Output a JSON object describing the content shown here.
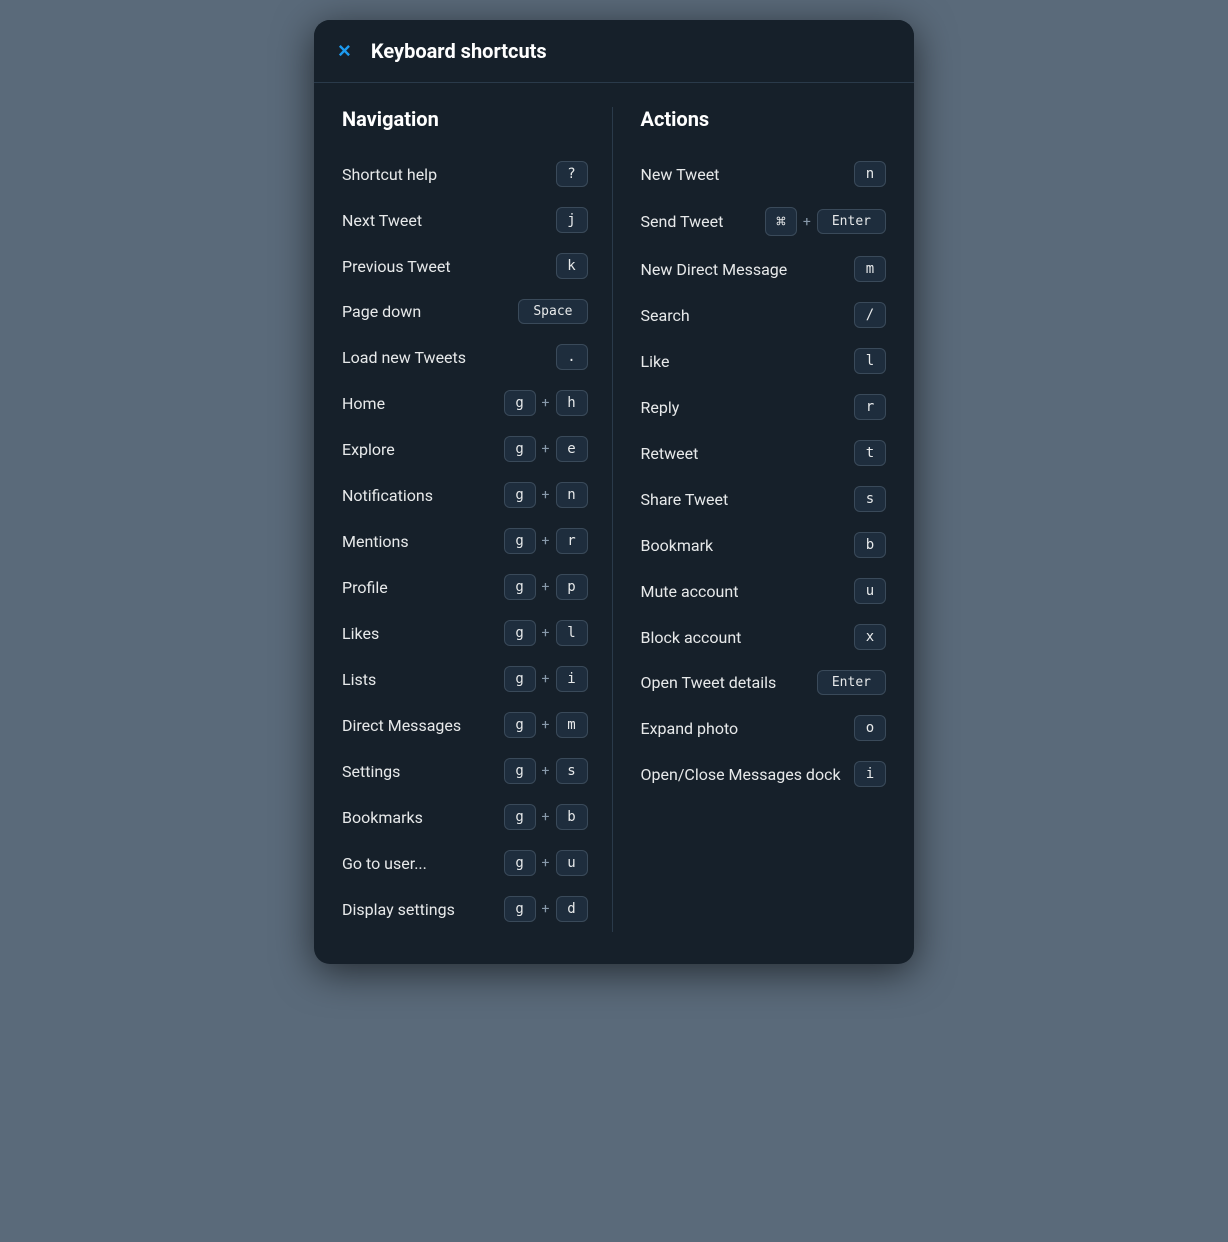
{
  "modal": {
    "title": "Keyboard shortcuts",
    "close_label": "×"
  },
  "navigation": {
    "section_title": "Navigation",
    "items": [
      {
        "label": "Shortcut help",
        "keys": [
          {
            "text": "?",
            "type": "normal"
          }
        ]
      },
      {
        "label": "Next Tweet",
        "keys": [
          {
            "text": "j",
            "type": "normal"
          }
        ]
      },
      {
        "label": "Previous Tweet",
        "keys": [
          {
            "text": "k",
            "type": "normal"
          }
        ]
      },
      {
        "label": "Page down",
        "keys": [
          {
            "text": "Space",
            "type": "wide"
          }
        ]
      },
      {
        "label": "Load new Tweets",
        "keys": [
          {
            "text": ".",
            "type": "normal"
          }
        ]
      },
      {
        "label": "Home",
        "keys": [
          {
            "text": "g",
            "type": "normal"
          },
          {
            "text": "+",
            "type": "plus"
          },
          {
            "text": "h",
            "type": "normal"
          }
        ]
      },
      {
        "label": "Explore",
        "keys": [
          {
            "text": "g",
            "type": "normal"
          },
          {
            "text": "+",
            "type": "plus"
          },
          {
            "text": "e",
            "type": "normal"
          }
        ]
      },
      {
        "label": "Notifications",
        "keys": [
          {
            "text": "g",
            "type": "normal"
          },
          {
            "text": "+",
            "type": "plus"
          },
          {
            "text": "n",
            "type": "normal"
          }
        ]
      },
      {
        "label": "Mentions",
        "keys": [
          {
            "text": "g",
            "type": "normal"
          },
          {
            "text": "+",
            "type": "plus"
          },
          {
            "text": "r",
            "type": "normal"
          }
        ]
      },
      {
        "label": "Profile",
        "keys": [
          {
            "text": "g",
            "type": "normal"
          },
          {
            "text": "+",
            "type": "plus"
          },
          {
            "text": "p",
            "type": "normal"
          }
        ]
      },
      {
        "label": "Likes",
        "keys": [
          {
            "text": "g",
            "type": "normal"
          },
          {
            "text": "+",
            "type": "plus"
          },
          {
            "text": "l",
            "type": "normal"
          }
        ]
      },
      {
        "label": "Lists",
        "keys": [
          {
            "text": "g",
            "type": "normal"
          },
          {
            "text": "+",
            "type": "plus"
          },
          {
            "text": "i",
            "type": "normal"
          }
        ]
      },
      {
        "label": "Direct Messages",
        "keys": [
          {
            "text": "g",
            "type": "normal"
          },
          {
            "text": "+",
            "type": "plus"
          },
          {
            "text": "m",
            "type": "normal"
          }
        ]
      },
      {
        "label": "Settings",
        "keys": [
          {
            "text": "g",
            "type": "normal"
          },
          {
            "text": "+",
            "type": "plus"
          },
          {
            "text": "s",
            "type": "normal"
          }
        ]
      },
      {
        "label": "Bookmarks",
        "keys": [
          {
            "text": "g",
            "type": "normal"
          },
          {
            "text": "+",
            "type": "plus"
          },
          {
            "text": "b",
            "type": "normal"
          }
        ]
      },
      {
        "label": "Go to user...",
        "keys": [
          {
            "text": "g",
            "type": "normal"
          },
          {
            "text": "+",
            "type": "plus"
          },
          {
            "text": "u",
            "type": "normal"
          }
        ]
      },
      {
        "label": "Display settings",
        "keys": [
          {
            "text": "g",
            "type": "normal"
          },
          {
            "text": "+",
            "type": "plus"
          },
          {
            "text": "d",
            "type": "normal"
          }
        ]
      }
    ]
  },
  "actions": {
    "section_title": "Actions",
    "items": [
      {
        "label": "New Tweet",
        "keys": [
          {
            "text": "n",
            "type": "normal"
          }
        ]
      },
      {
        "label": "Send Tweet",
        "keys": [
          {
            "text": "⌘",
            "type": "cmd"
          },
          {
            "text": "+",
            "type": "plus"
          },
          {
            "text": "Enter",
            "type": "wide"
          }
        ]
      },
      {
        "label": "New Direct Message",
        "keys": [
          {
            "text": "m",
            "type": "normal"
          }
        ]
      },
      {
        "label": "Search",
        "keys": [
          {
            "text": "/",
            "type": "normal"
          }
        ]
      },
      {
        "label": "Like",
        "keys": [
          {
            "text": "l",
            "type": "normal"
          }
        ]
      },
      {
        "label": "Reply",
        "keys": [
          {
            "text": "r",
            "type": "normal"
          }
        ]
      },
      {
        "label": "Retweet",
        "keys": [
          {
            "text": "t",
            "type": "normal"
          }
        ]
      },
      {
        "label": "Share Tweet",
        "keys": [
          {
            "text": "s",
            "type": "normal"
          }
        ]
      },
      {
        "label": "Bookmark",
        "keys": [
          {
            "text": "b",
            "type": "normal"
          }
        ]
      },
      {
        "label": "Mute account",
        "keys": [
          {
            "text": "u",
            "type": "normal"
          }
        ]
      },
      {
        "label": "Block account",
        "keys": [
          {
            "text": "x",
            "type": "normal"
          }
        ]
      },
      {
        "label": "Open Tweet details",
        "keys": [
          {
            "text": "Enter",
            "type": "wide"
          }
        ]
      },
      {
        "label": "Expand photo",
        "keys": [
          {
            "text": "o",
            "type": "normal"
          }
        ]
      },
      {
        "label": "Open/Close Messages dock",
        "keys": [
          {
            "text": "i",
            "type": "normal"
          }
        ]
      }
    ]
  }
}
